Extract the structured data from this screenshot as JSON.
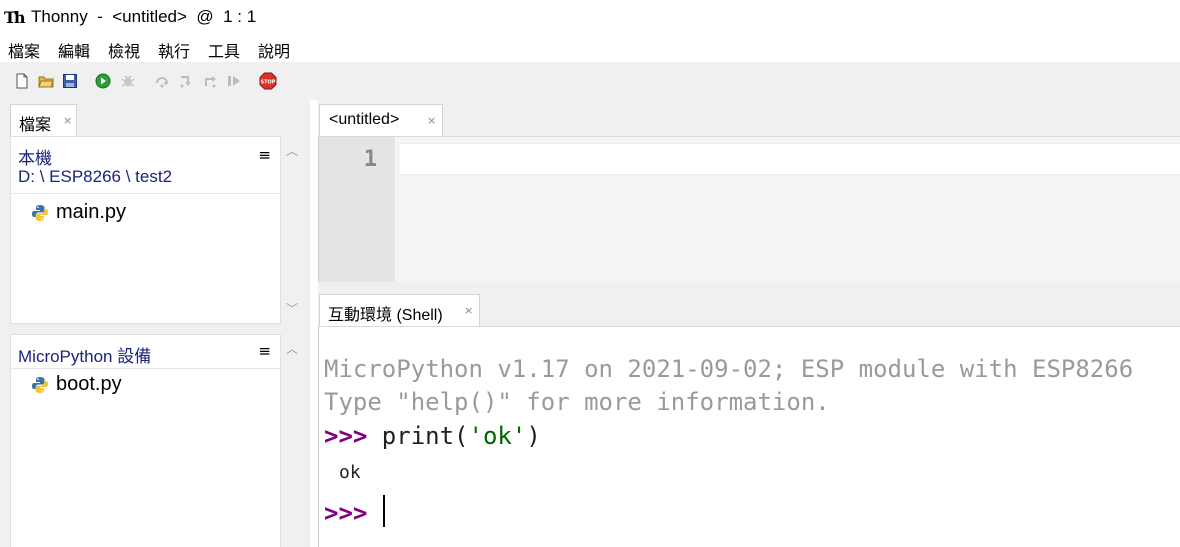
{
  "window": {
    "logo_text": "Th",
    "title": "Thonny  -  <untitled>  @  1 : 1"
  },
  "menu": [
    {
      "label": "檔案"
    },
    {
      "label": "編輯"
    },
    {
      "label": "檢視"
    },
    {
      "label": "執行"
    },
    {
      "label": "工具"
    },
    {
      "label": "說明"
    }
  ],
  "toolbar": {
    "icons": [
      "new-file-icon",
      "open-folder-icon",
      "save-icon",
      "run-icon",
      "debug-icon",
      "step-over-icon",
      "step-into-icon",
      "step-out-icon",
      "resume-icon",
      "stop-icon"
    ],
    "stop_label": "STOP"
  },
  "files_view": {
    "tab_label": "檔案",
    "local": {
      "title": "本機",
      "path": "D: \\ ESP8266 \\ test2",
      "menu_glyph": "≡",
      "files": [
        {
          "name": "main.py"
        }
      ]
    },
    "device": {
      "title": "MicroPython 設備",
      "menu_glyph": "≡",
      "files": [
        {
          "name": "boot.py"
        }
      ]
    }
  },
  "editor": {
    "tab_label": "<untitled>",
    "line_numbers": [
      "1"
    ],
    "content": ""
  },
  "shell": {
    "tab_label": "互動環境 (Shell)",
    "banner_lines": [
      "MicroPython v1.17 on 2021-09-02; ESP module with ESP8266",
      "Type \"help()\" for more information."
    ],
    "prompt": ">>>",
    "command_pre": " print(",
    "command_str": "'ok'",
    "command_post": ")",
    "output": "ok",
    "current_prompt": ">>>"
  },
  "colors": {
    "prompt": "#800080",
    "string": "#006400",
    "banner": "#9a9a9a",
    "location_title": "#1a237e",
    "chrome_bg": "#f0f0f0"
  }
}
